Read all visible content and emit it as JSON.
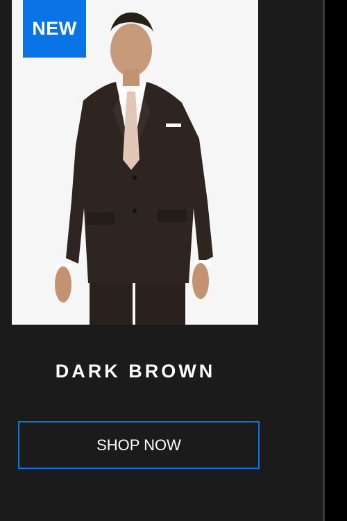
{
  "product": {
    "badge": "NEW",
    "name": "DARK BROWN",
    "cta_label": "SHOP NOW",
    "image_subject": "man-in-dark-brown-suit"
  },
  "colors": {
    "panel_background": "#1b1b1b",
    "accent_blue": "#0a73e6",
    "suit_brown": "#2e2420",
    "photo_background": "#f6f6f6"
  }
}
